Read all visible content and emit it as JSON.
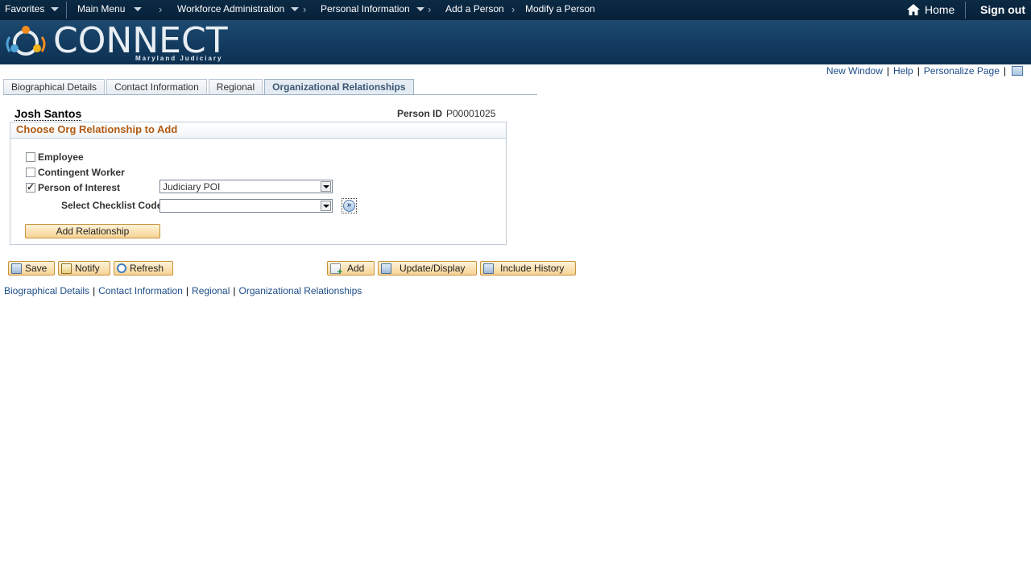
{
  "topnav": {
    "favorites": "Favorites",
    "main_menu": "Main Menu",
    "breadcrumb": [
      "Workforce Administration",
      "Personal Information",
      "Add a Person",
      "Modify a Person"
    ],
    "home": "Home",
    "sign_out": "Sign out"
  },
  "banner": {
    "logo_text": "CONNECT",
    "logo_subtitle": "Maryland Judiciary"
  },
  "page_actions": {
    "new_window": "New Window",
    "help": "Help",
    "personalize": "Personalize Page"
  },
  "tabs": [
    {
      "label": "Biographical Details",
      "active": false
    },
    {
      "label": "Contact Information",
      "active": false
    },
    {
      "label": "Regional",
      "active": false
    },
    {
      "label": "Organizational Relationships",
      "active": true
    }
  ],
  "person": {
    "name": "Josh Santos",
    "id_label": "Person ID",
    "id_value": "P00001025"
  },
  "group": {
    "title": "Choose Org Relationship to Add",
    "employee": {
      "label": "Employee",
      "checked": false
    },
    "contingent": {
      "label": "Contingent Worker",
      "checked": false
    },
    "poi": {
      "label": "Person of Interest",
      "checked": true,
      "type_value": "Judiciary POI"
    },
    "checklist_label": "Select Checklist Code",
    "checklist_value": "",
    "add_relationship": "Add Relationship"
  },
  "toolbar": {
    "save": "Save",
    "notify": "Notify",
    "refresh": "Refresh",
    "add": "Add",
    "update_display": "Update/Display",
    "include_history": "Include History"
  },
  "bottom_links": [
    "Biographical Details",
    "Contact Information",
    "Regional",
    "Organizational Relationships"
  ],
  "colors": {
    "nav_bg": "#07213a",
    "banner_bg": "#123a5e",
    "section_title": "#b25b11",
    "link": "#1d4d8a",
    "button_bg": "#f6d394"
  }
}
